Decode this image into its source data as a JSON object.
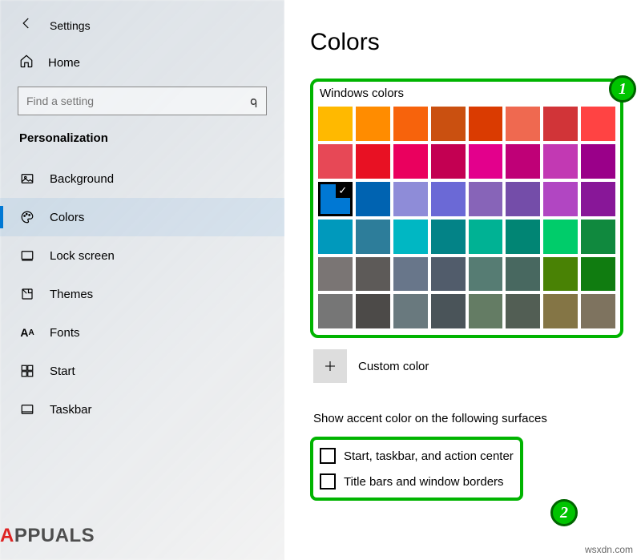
{
  "header": {
    "app_title": "Settings"
  },
  "home": {
    "label": "Home"
  },
  "search": {
    "placeholder": "Find a setting"
  },
  "section": {
    "title": "Personalization"
  },
  "nav": [
    {
      "key": "background",
      "label": "Background"
    },
    {
      "key": "colors",
      "label": "Colors",
      "active": true
    },
    {
      "key": "lock-screen",
      "label": "Lock screen"
    },
    {
      "key": "themes",
      "label": "Themes"
    },
    {
      "key": "fonts",
      "label": "Fonts"
    },
    {
      "key": "start",
      "label": "Start"
    },
    {
      "key": "taskbar",
      "label": "Taskbar"
    }
  ],
  "page": {
    "title": "Colors",
    "windows_colors_label": "Windows colors",
    "custom_color_label": "Custom color",
    "accent_heading": "Show accent color on the following surfaces",
    "option_start": "Start, taskbar, and action center",
    "option_titlebars": "Title bars and window borders"
  },
  "swatches": [
    [
      "#ffb900",
      "#ff8c00",
      "#f7630c",
      "#ca5010",
      "#da3b01",
      "#ef6950",
      "#d13438",
      "#ff4343"
    ],
    [
      "#e74856",
      "#e81123",
      "#ea005e",
      "#c30052",
      "#e3008c",
      "#bf0077",
      "#c239b3",
      "#9a0089"
    ],
    [
      "#0078d4",
      "#0063b1",
      "#8e8cd8",
      "#6b69d6",
      "#8764b8",
      "#744da9",
      "#b146c2",
      "#881798"
    ],
    [
      "#0099bc",
      "#2d7d9a",
      "#00b7c3",
      "#038387",
      "#00b294",
      "#018574",
      "#00cc6a",
      "#10893e"
    ],
    [
      "#7a7574",
      "#5d5a58",
      "#68768a",
      "#515c6b",
      "#567c73",
      "#486860",
      "#498205",
      "#107c10"
    ],
    [
      "#767676",
      "#4c4a48",
      "#69797e",
      "#4a5459",
      "#647c64",
      "#525e54",
      "#847545",
      "#7e735f"
    ]
  ],
  "selected_swatch": {
    "row": 2,
    "col": 0
  },
  "callouts": {
    "one": "1",
    "two": "2"
  },
  "watermark": {
    "logo_a": "A",
    "logo_rest": "PPUALS",
    "site": "wsxdn.com"
  }
}
